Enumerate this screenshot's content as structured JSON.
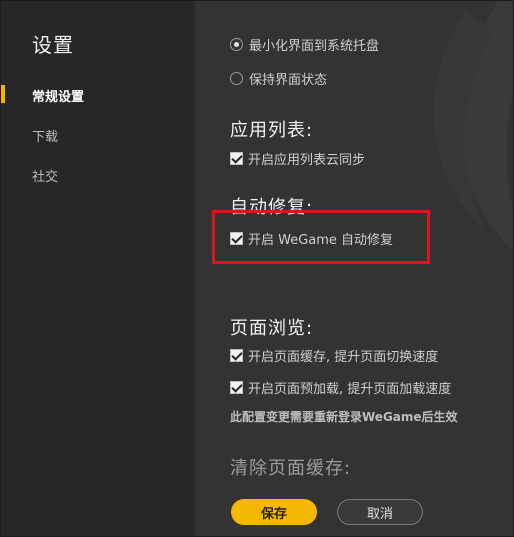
{
  "sidebar": {
    "title": "设置",
    "items": [
      {
        "label": "常规设置",
        "active": true
      },
      {
        "label": "下载",
        "active": false
      },
      {
        "label": "社交",
        "active": false
      }
    ]
  },
  "main": {
    "close_behavior": {
      "options": [
        {
          "label": "最小化界面到系统托盘",
          "selected": true
        },
        {
          "label": "保持界面状态",
          "selected": false
        }
      ]
    },
    "app_list": {
      "title": "应用列表:",
      "options": [
        {
          "label": "开启应用列表云同步",
          "checked": true
        }
      ]
    },
    "auto_repair": {
      "title": "自动修复:",
      "options": [
        {
          "label": "开启 WeGame 自动修复",
          "checked": true
        }
      ]
    },
    "page_browse": {
      "title": "页面浏览:",
      "options": [
        {
          "label": "开启页面缓存, 提升页面切换速度",
          "checked": true
        },
        {
          "label": "开启页面预加载, 提升页面加载速度",
          "checked": true
        }
      ],
      "note": "此配置变更需要重新登录WeGame后生效"
    },
    "clear_cache": {
      "title": "清除页面缓存:"
    },
    "buttons": {
      "save_label": "保存",
      "cancel_label": "取消"
    }
  },
  "colors": {
    "accent": "#f5b800",
    "highlight_border": "#d9161c",
    "sidebar_bg": "#272727",
    "main_bg": "#333333"
  }
}
